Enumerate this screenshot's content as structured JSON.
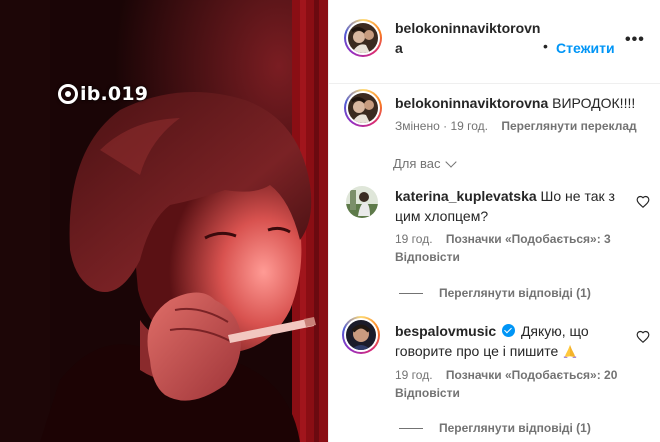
{
  "media": {
    "watermark": "ib.019",
    "mark_icon": "threads-logo-icon"
  },
  "post": {
    "username_line1": "belokoninnaviktorovn",
    "username_line2": "a",
    "separator": "•",
    "follow_label": "Стежити",
    "more_icon": "more-options-icon",
    "more_label": "•••"
  },
  "caption": {
    "username": "belokoninnaviktorovna",
    "text": "ВИРОДОК!!!!",
    "edited_label": "Змінено",
    "separator": "·",
    "time": "19 год.",
    "translate_label": "Переглянути переклад"
  },
  "sort": {
    "label": "Для вас",
    "icon": "chevron-down-icon"
  },
  "comments": [
    {
      "username": "katerina_kuplevatska",
      "text": "Шо не так з цим хлопцем?",
      "time": "19 год.",
      "likes_label": "Позначки «Подобається»: 3",
      "reply_label": "Відповісти",
      "view_replies": "Переглянути відповіді (1)",
      "verified": false
    },
    {
      "username": "bespalovmusic",
      "text": "Дякую, що говорите про це і пишите",
      "emoji_icon": "folded-hands-icon",
      "time": "19 год.",
      "likes_label": "Позначки «Подобається»: 20",
      "reply_label": "Відповісти",
      "view_replies": "Переглянути відповіді (1)",
      "verified": true
    }
  ],
  "colors": {
    "link_blue": "#0095f6",
    "text": "#262626",
    "secondary": "#737373",
    "divider": "#efefef"
  }
}
